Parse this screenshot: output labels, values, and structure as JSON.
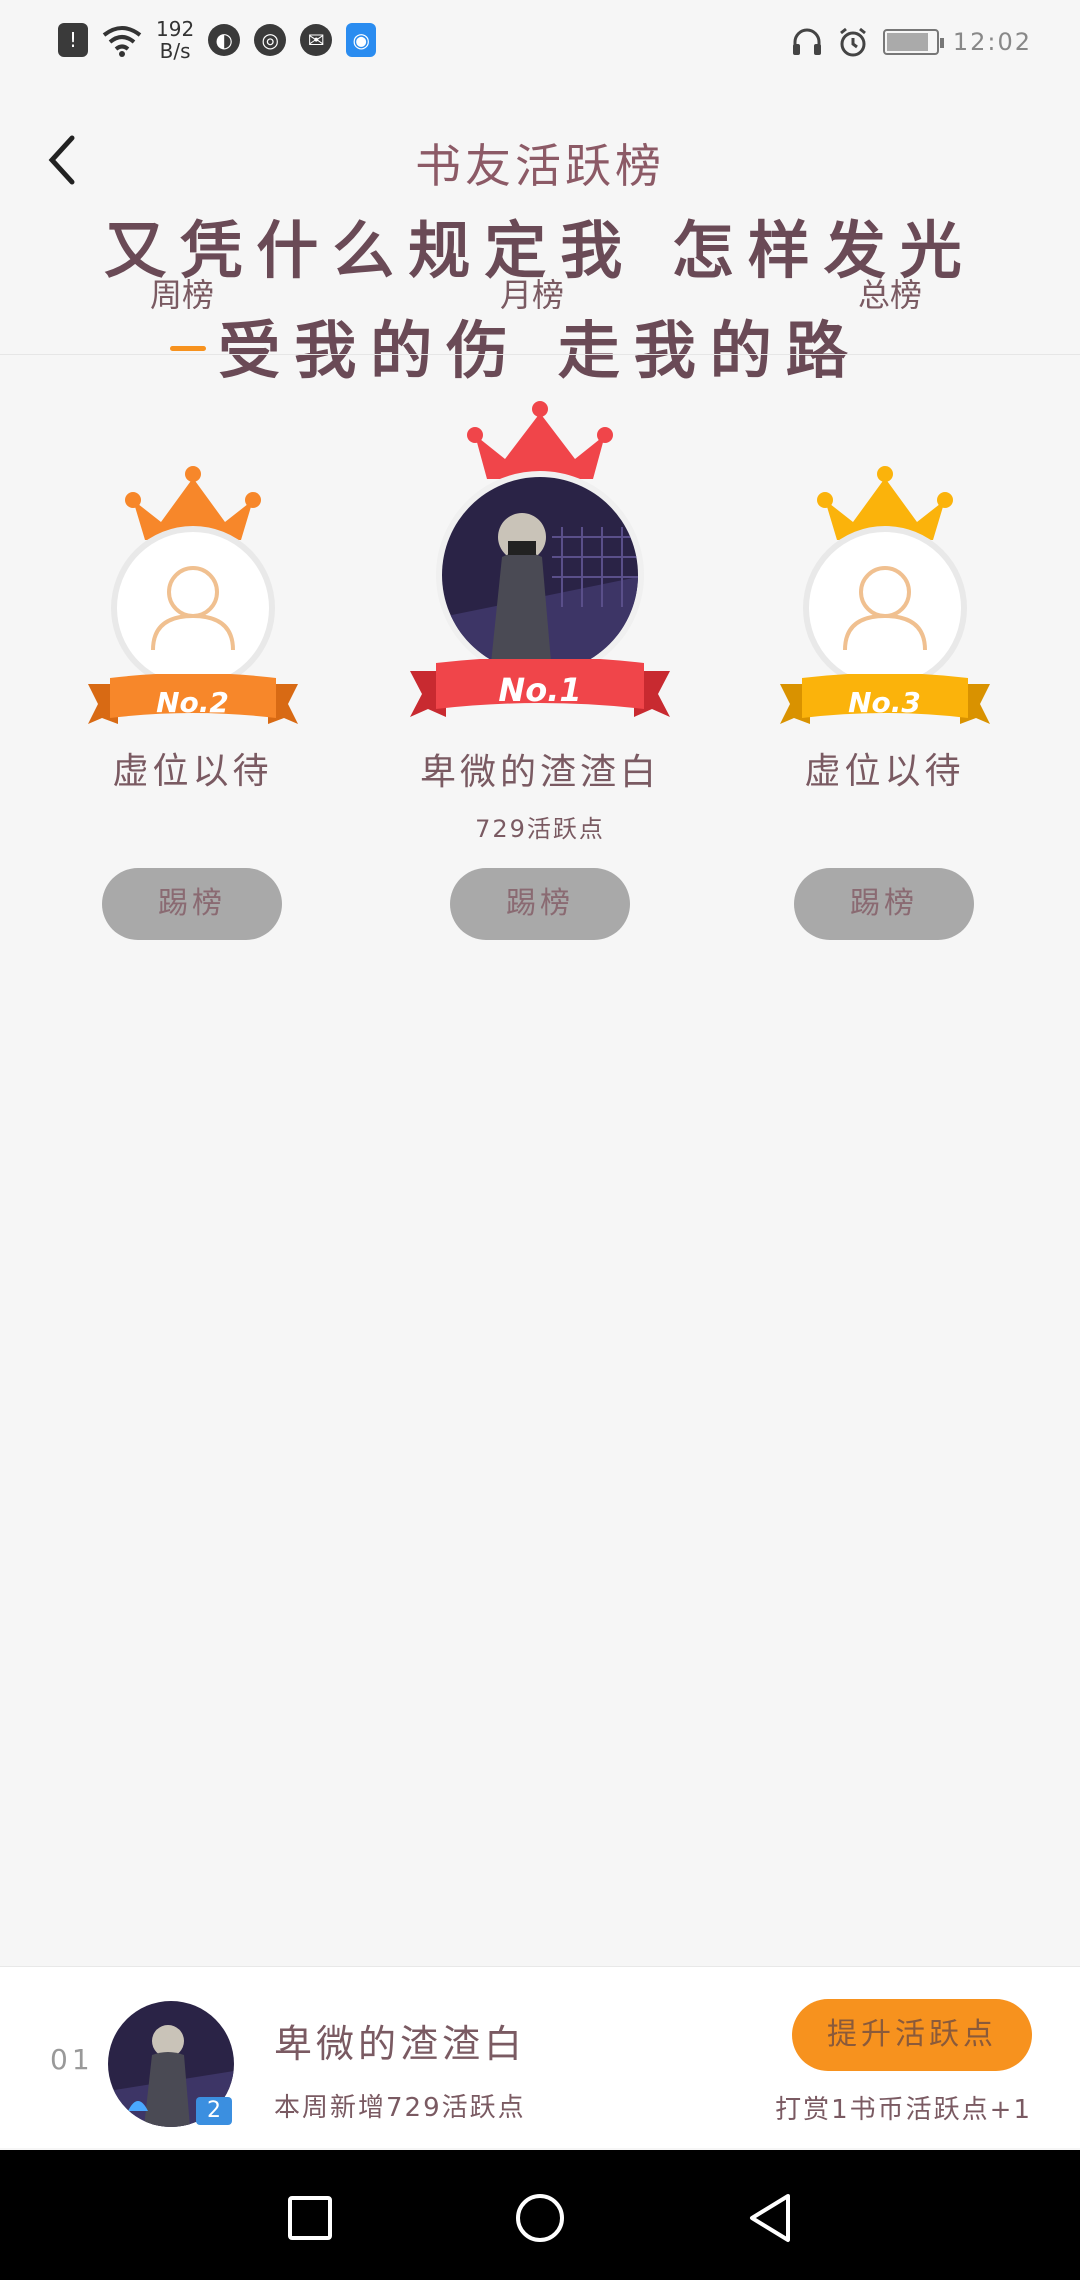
{
  "status_bar": {
    "speed_value": "192",
    "speed_unit": "B/s",
    "clock": "12:02",
    "battery_level": 0.85
  },
  "header": {
    "back_icon": "chevron-left-icon",
    "title": "书友活跃榜",
    "overlay_line_1": "又凭什么规定我 怎样发光",
    "overlay_line_2": "受我的伤 走我的路"
  },
  "tabs": [
    {
      "label": "周榜",
      "active": true
    },
    {
      "label": "月榜",
      "active": false
    },
    {
      "label": "总榜",
      "active": false
    }
  ],
  "podium": {
    "first": {
      "rank": "No.1",
      "name": "卑微的渣渣白",
      "points": "729活跃点",
      "button": "踢榜",
      "color": "#f0454a"
    },
    "second": {
      "rank": "No.2",
      "name": "虚位以待",
      "button": "踢榜",
      "color": "#f7872a"
    },
    "third": {
      "rank": "No.3",
      "name": "虚位以待",
      "button": "踢榜",
      "color": "#fbb30b"
    }
  },
  "me": {
    "rank": "01",
    "badge": "2",
    "name": "卑微的渣渣白",
    "sub": "本周新增729活跃点",
    "boost_button": "提升活跃点",
    "reward_note": "打赏1书币活跃点+1"
  },
  "colors": {
    "accent": "#f7921e",
    "button_grey": "#a9a9a9",
    "text": "#7a5a62"
  }
}
